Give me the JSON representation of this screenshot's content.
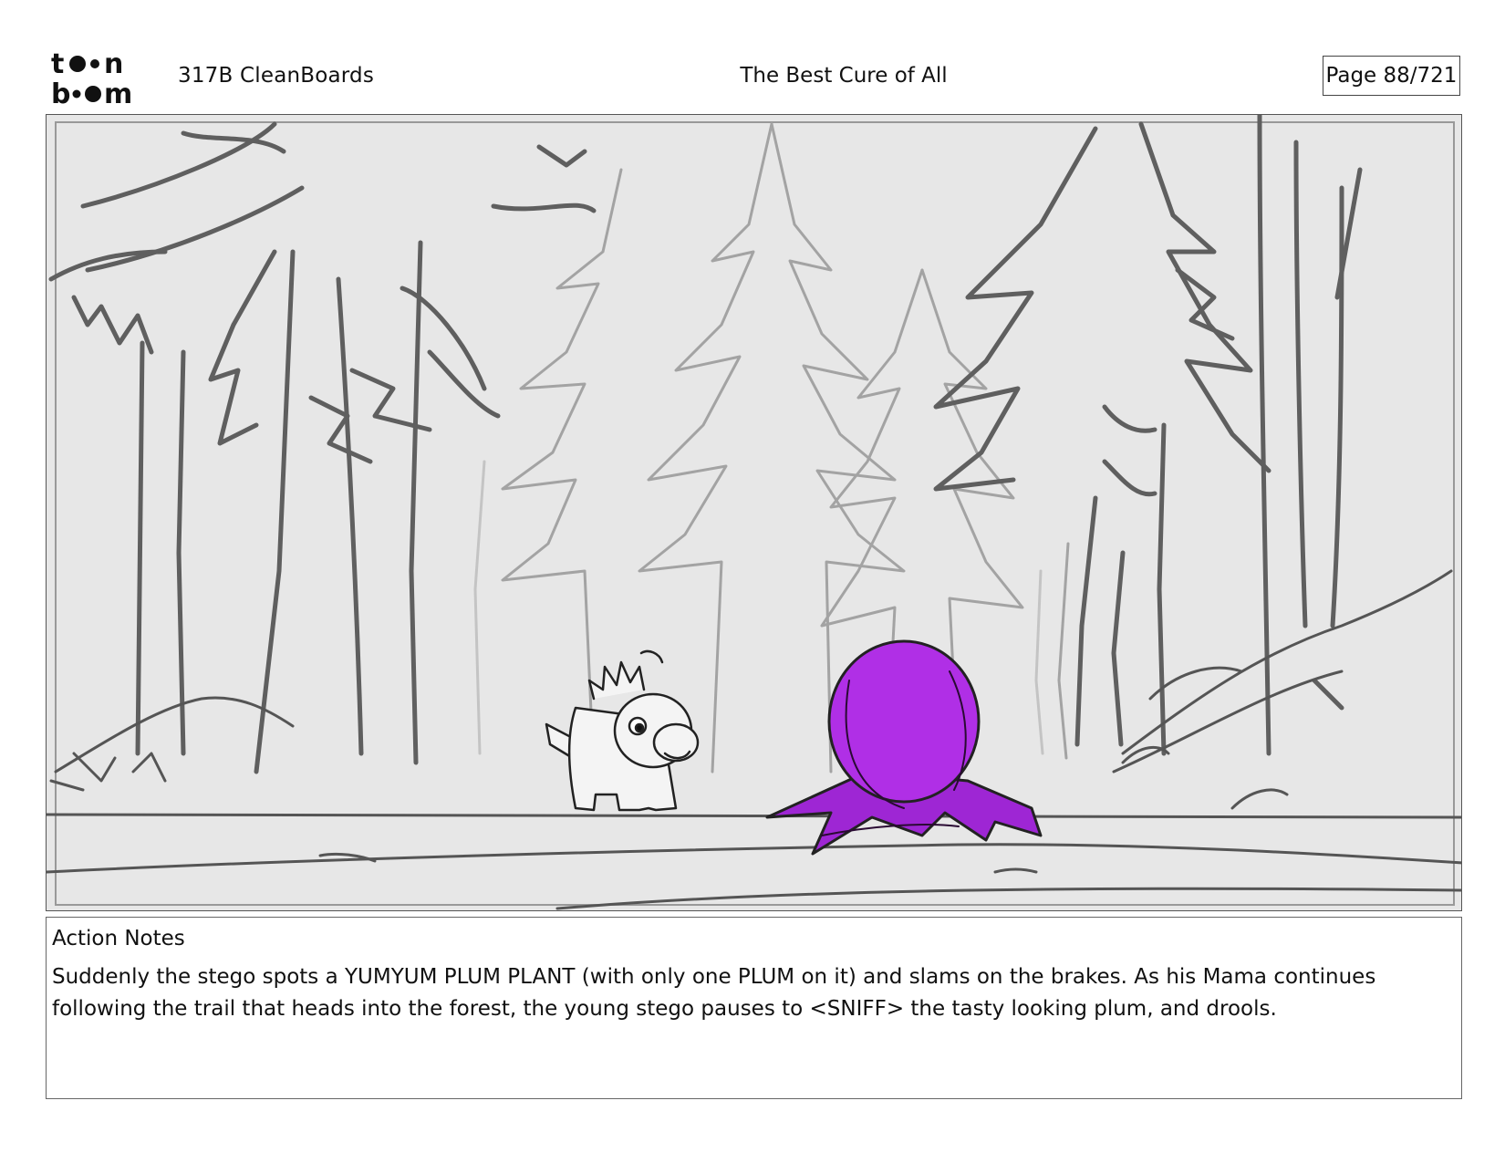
{
  "header": {
    "logo_text": "toon boom",
    "episode": "317B  CleanBoards",
    "title": "The Best Cure of All",
    "page": "Page  88/721"
  },
  "panel": {
    "icons": [
      "forest-background",
      "young-stego-character",
      "yumyum-plum-plant"
    ],
    "colors": {
      "plum": "#b02fe6",
      "background": "#e7e7e7",
      "outline": "#555555"
    }
  },
  "notes": {
    "label": "Action Notes",
    "text": "Suddenly the stego spots a YUMYUM PLUM PLANT (with only one PLUM on it) and slams on the brakes. As his Mama continues following the trail that heads into the forest, the young stego pauses to <SNIFF> the tasty looking plum, and drools."
  }
}
